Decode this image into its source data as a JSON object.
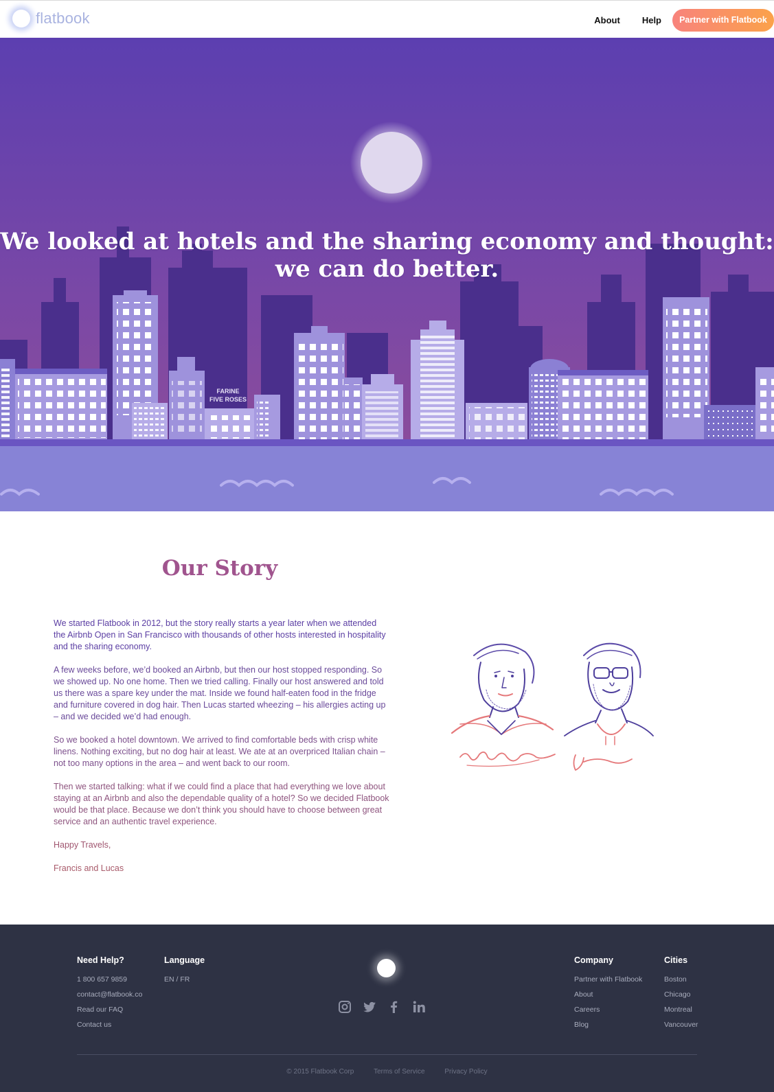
{
  "header": {
    "logo_text": "flatbook",
    "nav": {
      "about": "About",
      "help": "Help",
      "partner_button": "Partner with Flatbook"
    }
  },
  "hero": {
    "title_line1": "We looked at hotels and the sharing economy and thought:",
    "title_line2": "we can do better.",
    "sign_line1": "FARINE",
    "sign_line2": "FIVE ROSES"
  },
  "story": {
    "title": "Our Story",
    "paragraphs": [
      "We started Flatbook in 2012, but the story really starts a year later when we attended the Airbnb Open in San Francisco with thousands of other hosts interested in hospitality and the sharing economy.",
      "A few weeks before, we’d booked an Airbnb, but then our host stopped responding. So we showed up. No one home. Then we tried calling. Finally our host answered and told us there was a spare key under the mat. Inside we found half-eaten food in the fridge and furniture covered in dog hair. Then Lucas started wheezing – his allergies acting up – and we decided we’d had enough.",
      "So we booked a hotel downtown. We arrived to find comfortable beds with crisp white linens. Nothing exciting, but no dog hair at least. We ate at an overpriced Italian chain – not too many options in the area – and went back to our room.",
      "Then we started talking: what if we could find a place that had everything we love about staying at an Airbnb and also the dependable quality of a hotel? So we decided Flatbook would be that place. Because we don’t think you should have to choose between great service and an authentic travel experience.",
      "Happy Travels,",
      "Francis and Lucas"
    ],
    "text_colors": [
      "#5b3ea3",
      "#6a4a9a",
      "#7c4f8c",
      "#8e547e",
      "#a05670",
      "#a85a6a"
    ]
  },
  "footer": {
    "need_help": {
      "heading": "Need Help?",
      "links": [
        "1 800 657 9859",
        "contact@flatbook.co",
        "Read our FAQ",
        "Contact us"
      ]
    },
    "language": {
      "heading": "Language",
      "value": "EN / FR"
    },
    "company": {
      "heading": "Company",
      "links": [
        "Partner with Flatbook",
        "About",
        "Careers",
        "Blog"
      ]
    },
    "cities": {
      "heading": "Cities",
      "links": [
        "Boston",
        "Chicago",
        "Montreal",
        "Vancouver"
      ]
    },
    "social_icons": [
      "instagram-icon",
      "twitter-icon",
      "facebook-icon",
      "linkedin-icon"
    ],
    "copyright": "© 2015 Flatbook Corp",
    "terms": "Terms of Service",
    "privacy": "Privacy Policy"
  }
}
